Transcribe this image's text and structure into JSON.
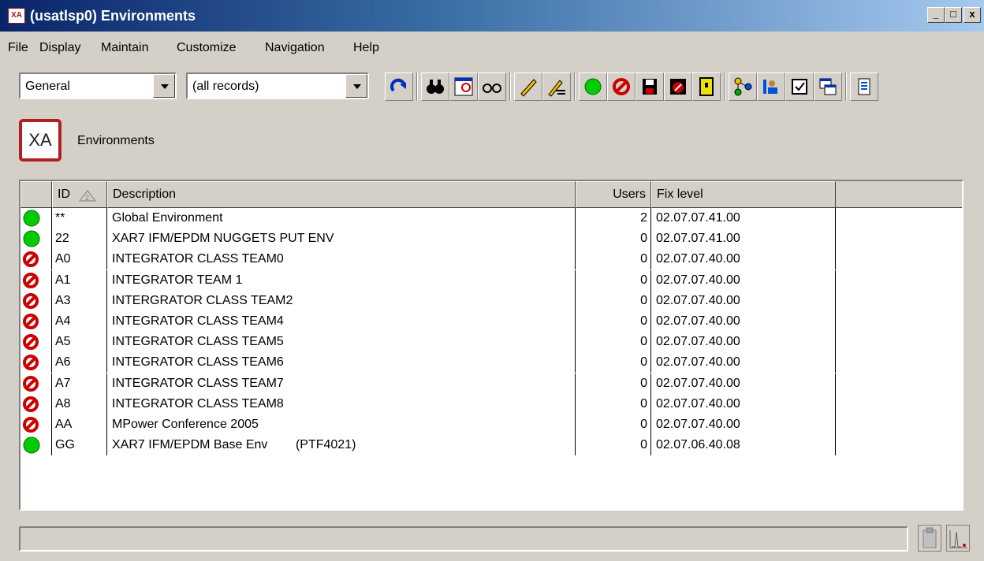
{
  "window": {
    "icon_text": "XA",
    "title": "(usatlsp0) Environments",
    "minimize": "_",
    "maximize": "□",
    "close": "x"
  },
  "menu": [
    "File",
    "Display",
    "Maintain",
    "Customize",
    "Navigation",
    "Help"
  ],
  "toolbar": {
    "view_select": "General",
    "filter_select": "(all records)",
    "buttons": [
      "refresh-icon",
      "binoculars-icon",
      "find-record-icon",
      "glasses-icon",
      "pencil-icon",
      "edit-list-icon",
      "green-circle-icon",
      "no-entry-icon",
      "save-icon",
      "stop-disk-icon",
      "yellow-door-icon",
      "hierarchy-icon",
      "users-icon",
      "checklist-icon",
      "windows-icon",
      "export-icon"
    ]
  },
  "page": {
    "logo_text": "XA",
    "heading": "Environments"
  },
  "table": {
    "columns": {
      "id": "ID",
      "sort_indicator": "2",
      "description": "Description",
      "users": "Users",
      "fix_level": "Fix level"
    },
    "rows": [
      {
        "status": "active",
        "id": "**",
        "description": "Global Environment",
        "users": "2",
        "fix_level": "02.07.07.41.00"
      },
      {
        "status": "active",
        "id": "22",
        "description": "XAR7 IFM/EPDM NUGGETS PUT ENV",
        "users": "0",
        "fix_level": "02.07.07.41.00"
      },
      {
        "status": "inactive",
        "id": "A0",
        "description": "INTEGRATOR CLASS TEAM0",
        "users": "0",
        "fix_level": "02.07.07.40.00"
      },
      {
        "status": "inactive",
        "id": "A1",
        "description": "INTEGRATOR TEAM 1",
        "users": "0",
        "fix_level": "02.07.07.40.00"
      },
      {
        "status": "inactive",
        "id": "A3",
        "description": "INTERGRATOR CLASS TEAM2",
        "users": "0",
        "fix_level": "02.07.07.40.00"
      },
      {
        "status": "inactive",
        "id": "A4",
        "description": "INTEGRATOR CLASS TEAM4",
        "users": "0",
        "fix_level": "02.07.07.40.00"
      },
      {
        "status": "inactive",
        "id": "A5",
        "description": "INTEGRATOR CLASS TEAM5",
        "users": "0",
        "fix_level": "02.07.07.40.00"
      },
      {
        "status": "inactive",
        "id": "A6",
        "description": "INTEGRATOR CLASS TEAM6",
        "users": "0",
        "fix_level": "02.07.07.40.00"
      },
      {
        "status": "inactive",
        "id": "A7",
        "description": "INTEGRATOR CLASS TEAM7",
        "users": "0",
        "fix_level": "02.07.07.40.00"
      },
      {
        "status": "inactive",
        "id": "A8",
        "description": "INTEGRATOR CLASS TEAM8",
        "users": "0",
        "fix_level": "02.07.07.40.00"
      },
      {
        "status": "inactive",
        "id": "AA",
        "description": "MPower Conference 2005",
        "users": "0",
        "fix_level": "02.07.07.40.00"
      },
      {
        "status": "active",
        "id": "GG",
        "description": "XAR7 IFM/EPDM Base Env        (PTF4021)",
        "users": "0",
        "fix_level": "02.07.06.40.08"
      }
    ]
  },
  "colors": {
    "active": "#00cc00",
    "inactive": "#cc0000",
    "title_start": "#0a246a",
    "title_end": "#a6caf0"
  },
  "statusbar": {
    "text": "",
    "icons": [
      "clipboard-icon",
      "chart-icon"
    ]
  }
}
